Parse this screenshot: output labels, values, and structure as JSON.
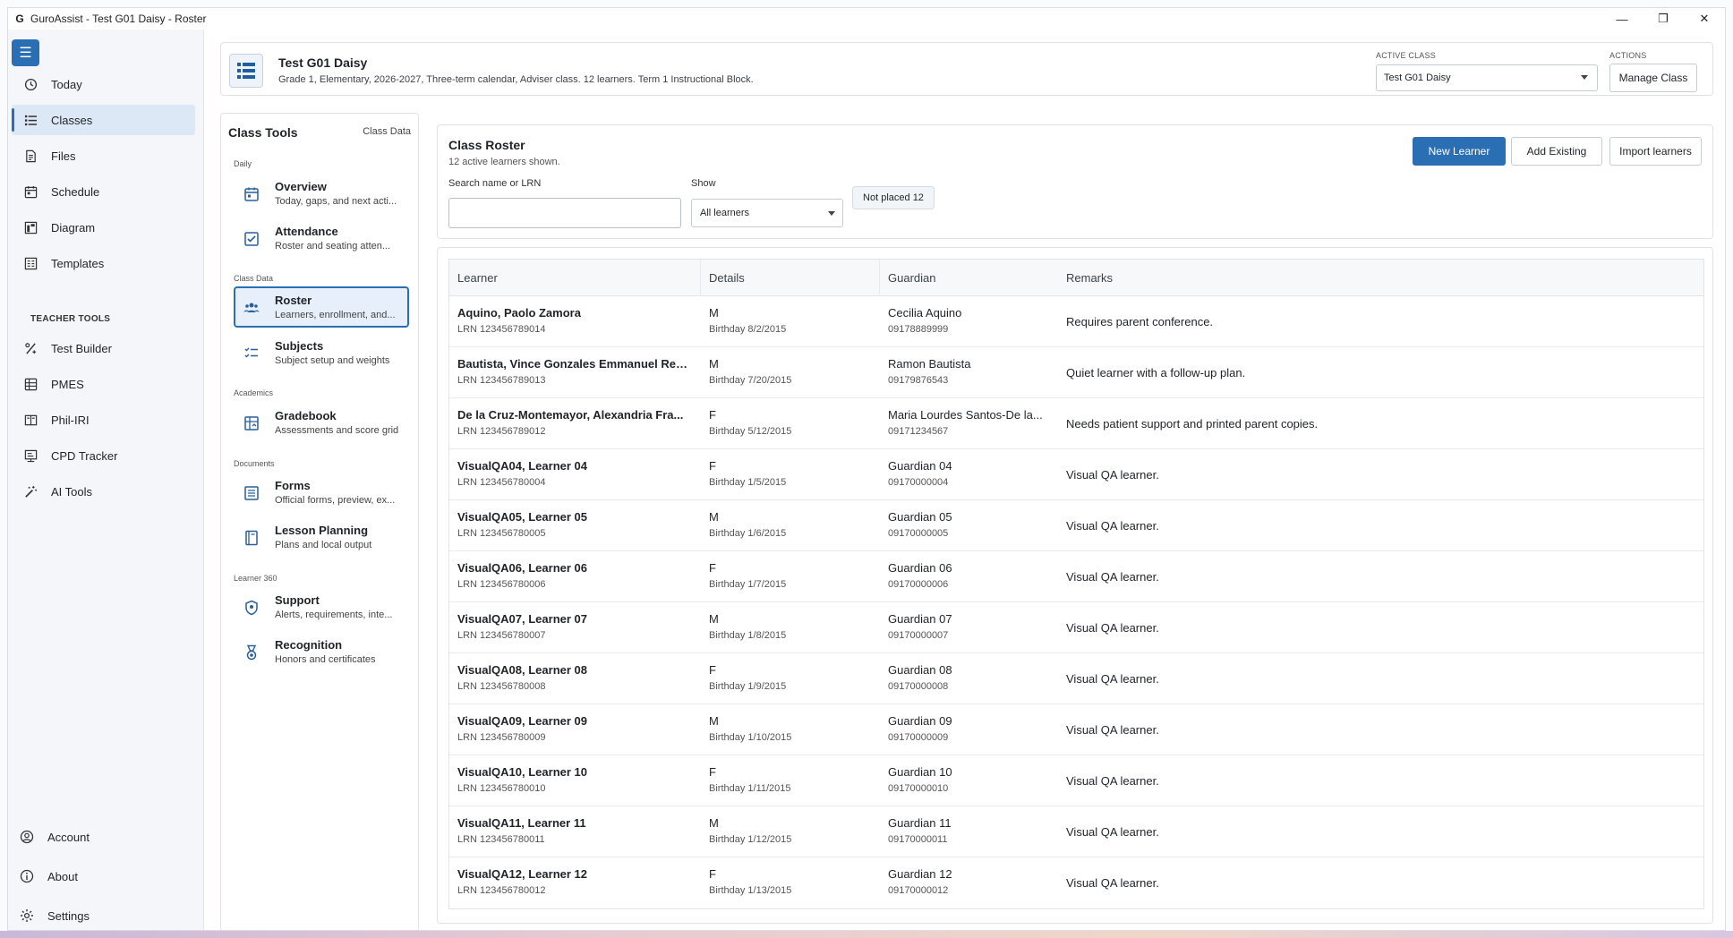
{
  "window": {
    "title": "GuroAssist - Test G01 Daisy - Roster",
    "app_icon": "G",
    "controls": {
      "minimize": "—",
      "restore": "❐",
      "close": "✕"
    }
  },
  "nav": {
    "menu_icon": "☰",
    "items": [
      {
        "label": "Today",
        "icon": "clock-icon"
      },
      {
        "label": "Classes",
        "icon": "list-icon",
        "active": true
      },
      {
        "label": "Files",
        "icon": "file-icon"
      },
      {
        "label": "Schedule",
        "icon": "calendar-icon"
      },
      {
        "label": "Diagram",
        "icon": "diagram-icon"
      },
      {
        "label": "Templates",
        "icon": "template-icon"
      }
    ],
    "teacher_tools_heading": "TEACHER TOOLS",
    "teacher_tools": [
      {
        "label": "Test Builder",
        "icon": "percent-icon"
      },
      {
        "label": "PMES",
        "icon": "table-icon"
      },
      {
        "label": "Phil-IRI",
        "icon": "book-icon"
      },
      {
        "label": "CPD Tracker",
        "icon": "tracker-icon"
      },
      {
        "label": "AI Tools",
        "icon": "wand-icon"
      }
    ],
    "footer": [
      {
        "label": "Account",
        "icon": "account-icon"
      },
      {
        "label": "About",
        "icon": "info-icon"
      },
      {
        "label": "Settings",
        "icon": "gear-icon"
      }
    ]
  },
  "header": {
    "class_name": "Test G01 Daisy",
    "class_details": "Grade 1, Elementary, 2026-2027, Three-term calendar, Adviser class. 12 learners. Term 1 Instructional Block.",
    "active_class_label": "ACTIVE CLASS",
    "active_class_value": "Test G01 Daisy",
    "actions_label": "ACTIONS",
    "manage_class_label": "Manage Class"
  },
  "class_tools": {
    "title": "Class Tools",
    "class_data_link": "Class Data",
    "groups": {
      "daily": "Daily",
      "class_data": "Class Data",
      "academics": "Academics",
      "documents": "Documents",
      "learner360": "Learner 360"
    },
    "items": {
      "overview": {
        "name": "Overview",
        "desc": "Today, gaps, and next acti..."
      },
      "attendance": {
        "name": "Attendance",
        "desc": "Roster and seating atten..."
      },
      "roster": {
        "name": "Roster",
        "desc": "Learners, enrollment, and..."
      },
      "subjects": {
        "name": "Subjects",
        "desc": "Subject setup and weights"
      },
      "gradebook": {
        "name": "Gradebook",
        "desc": "Assessments and score grid"
      },
      "forms": {
        "name": "Forms",
        "desc": "Official forms, preview, ex..."
      },
      "lesson_planning": {
        "name": "Lesson Planning",
        "desc": "Plans and local output"
      },
      "support": {
        "name": "Support",
        "desc": "Alerts, requirements, inte..."
      },
      "recognition": {
        "name": "Recognition",
        "desc": "Honors and certificates"
      }
    }
  },
  "roster": {
    "title": "Class Roster",
    "subtitle": "12 active learners shown.",
    "search_label": "Search name or LRN",
    "search_value": "",
    "show_label": "Show",
    "show_value": "All learners",
    "not_placed_badge": "Not placed 12",
    "new_learner_label": "New Learner",
    "add_existing_label": "Add Existing",
    "import_label": "Import learners"
  },
  "table": {
    "headers": [
      "Learner",
      "Details",
      "Guardian",
      "Remarks"
    ],
    "rows": [
      {
        "name": "Aquino, Paolo Zamora",
        "lrn": "LRN 123456789014",
        "sex": "M",
        "birthday": "Birthday 8/2/2015",
        "guardian": "Cecilia Aquino",
        "phone": "09178889999",
        "remarks": "Requires parent conference."
      },
      {
        "name": "Bautista, Vince Gonzales Emmanuel Reyes",
        "lrn": "LRN 123456789013",
        "sex": "M",
        "birthday": "Birthday 7/20/2015",
        "guardian": "Ramon Bautista",
        "phone": "09179876543",
        "remarks": "Quiet learner with a follow-up plan."
      },
      {
        "name": "De la Cruz-Montemayor, Alexandria Fra...",
        "lrn": "LRN 123456789012",
        "sex": "F",
        "birthday": "Birthday 5/12/2015",
        "guardian": "Maria Lourdes Santos-De la...",
        "phone": "09171234567",
        "remarks": "Needs patient support and printed parent copies."
      },
      {
        "name": "VisualQA04, Learner 04",
        "lrn": "LRN 123456780004",
        "sex": "F",
        "birthday": "Birthday 1/5/2015",
        "guardian": "Guardian 04",
        "phone": "09170000004",
        "remarks": "Visual QA learner."
      },
      {
        "name": "VisualQA05, Learner 05",
        "lrn": "LRN 123456780005",
        "sex": "M",
        "birthday": "Birthday 1/6/2015",
        "guardian": "Guardian 05",
        "phone": "09170000005",
        "remarks": "Visual QA learner."
      },
      {
        "name": "VisualQA06, Learner 06",
        "lrn": "LRN 123456780006",
        "sex": "F",
        "birthday": "Birthday 1/7/2015",
        "guardian": "Guardian 06",
        "phone": "09170000006",
        "remarks": "Visual QA learner."
      },
      {
        "name": "VisualQA07, Learner 07",
        "lrn": "LRN 123456780007",
        "sex": "M",
        "birthday": "Birthday 1/8/2015",
        "guardian": "Guardian 07",
        "phone": "09170000007",
        "remarks": "Visual QA learner."
      },
      {
        "name": "VisualQA08, Learner 08",
        "lrn": "LRN 123456780008",
        "sex": "F",
        "birthday": "Birthday 1/9/2015",
        "guardian": "Guardian 08",
        "phone": "09170000008",
        "remarks": "Visual QA learner."
      },
      {
        "name": "VisualQA09, Learner 09",
        "lrn": "LRN 123456780009",
        "sex": "M",
        "birthday": "Birthday 1/10/2015",
        "guardian": "Guardian 09",
        "phone": "09170000009",
        "remarks": "Visual QA learner."
      },
      {
        "name": "VisualQA10, Learner 10",
        "lrn": "LRN 123456780010",
        "sex": "F",
        "birthday": "Birthday 1/11/2015",
        "guardian": "Guardian 10",
        "phone": "09170000010",
        "remarks": "Visual QA learner."
      },
      {
        "name": "VisualQA11, Learner 11",
        "lrn": "LRN 123456780011",
        "sex": "M",
        "birthday": "Birthday 1/12/2015",
        "guardian": "Guardian 11",
        "phone": "09170000011",
        "remarks": "Visual QA learner."
      },
      {
        "name": "VisualQA12, Learner 12",
        "lrn": "LRN 123456780012",
        "sex": "F",
        "birthday": "Birthday 1/13/2015",
        "guardian": "Guardian 12",
        "phone": "09170000012",
        "remarks": "Visual QA learner."
      }
    ]
  },
  "colors": {
    "accent": "#2a6fb3",
    "active_nav": "#dce8f6"
  }
}
